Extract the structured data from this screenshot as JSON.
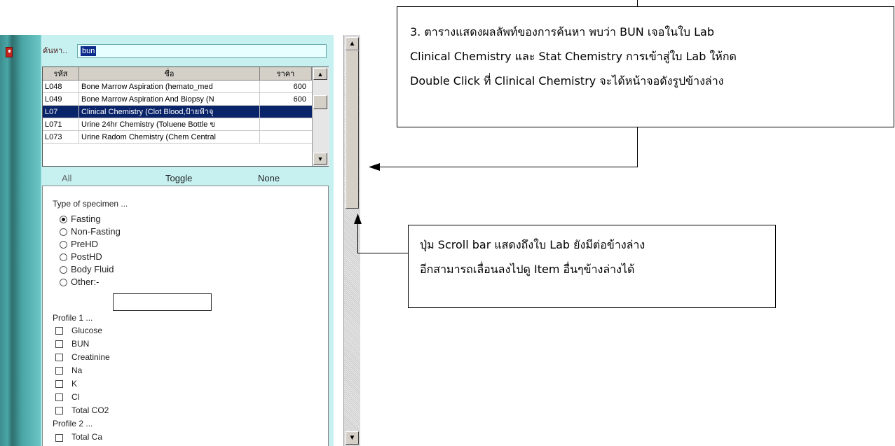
{
  "search": {
    "label": "ค้นหา..",
    "value": "bun"
  },
  "table": {
    "headers": [
      "รหัส",
      "ชื่อ",
      "ราคา"
    ],
    "rows": [
      {
        "code": "L048",
        "name": "Bone Marrow Aspiration (hemato_med",
        "price": "600"
      },
      {
        "code": "L049",
        "name": "Bone Marrow Aspiration And Biopsy (N",
        "price": "600"
      },
      {
        "code": "L07",
        "name": "Clinical Chemistry  (Clot Blood,ป้ายฟ้าจุ",
        "price": ""
      },
      {
        "code": "L071",
        "name": "Urine 24hr Chemistry (Toluene Bottle ข",
        "price": ""
      },
      {
        "code": "L073",
        "name": "Urine Radom Chemistry (Chem Central",
        "price": ""
      }
    ]
  },
  "toggle_bar": {
    "all": "All",
    "toggle": "Toggle",
    "none": "None"
  },
  "form": {
    "specimen_title": "Type of specimen ...",
    "specimen_options": [
      "Fasting",
      "Non-Fasting",
      "PreHD",
      "PostHD",
      "Body Fluid",
      "Other:-"
    ],
    "specimen_selected": "Fasting",
    "profile1_title": "Profile 1 ...",
    "profile1_items": [
      "Glucose",
      "BUN",
      "Creatinine",
      "Na",
      "K",
      "Cl",
      "Total CO2"
    ],
    "profile2_title": "Profile 2 ...",
    "profile2_items": [
      "Total Ca"
    ]
  },
  "annotations": {
    "callout1_lines": [
      "3. ตารางแสดงผลลัพท์ของการค้นหา พบว่า BUN เจอในใบ Lab",
      "Clinical Chemistry และ Stat Chemistry การเข้าสู่ใบ Lab ให้กด",
      "Double Click ที่ Clinical Chemistry จะได้หน้าจอดังรูปข้างล่าง"
    ],
    "callout2_lines": [
      "ปุ่ม Scroll bar แสดงถึงใบ Lab ยังมีต่อข้างล่าง",
      "อีกสามารถเลื่อนลงไปดู Item อื่นๆข้างล่างได้"
    ]
  }
}
